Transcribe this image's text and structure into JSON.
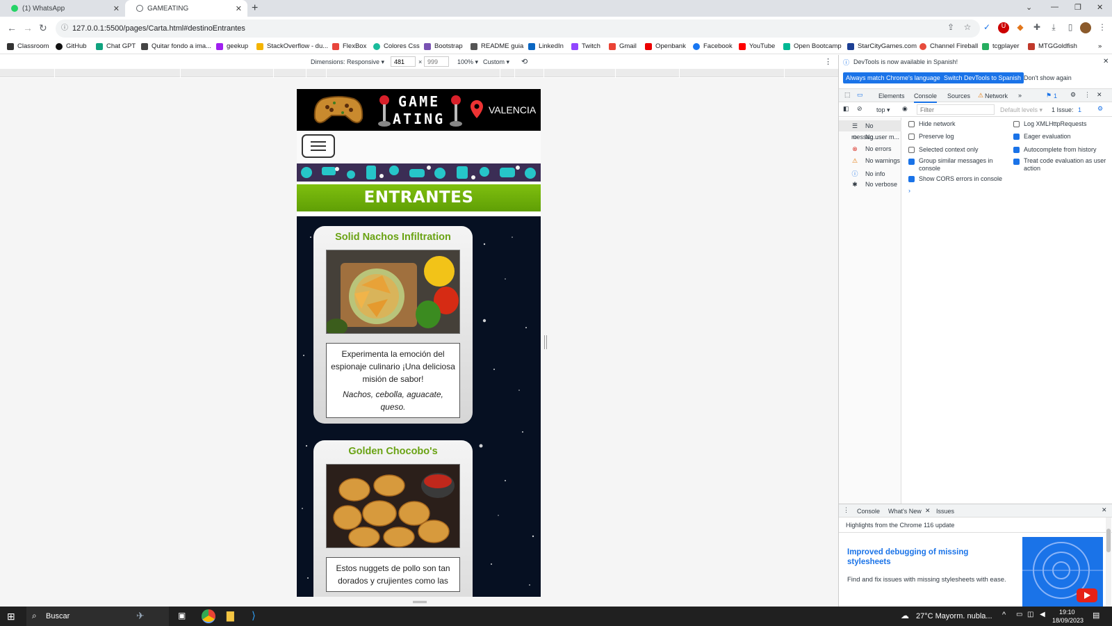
{
  "browser": {
    "tabs": [
      {
        "label": "(1) WhatsApp",
        "icon": "whatsapp-icon"
      },
      {
        "label": "GAMEATING",
        "icon": "globe-icon"
      }
    ],
    "url": "127.0.0.1:5500/pages/Carta.html#destinoEntrantes",
    "bookmarks": [
      "Classroom",
      "GitHub",
      "Chat GPT",
      "Quitar fondo a ima...",
      "geekup",
      "StackOverflow - du...",
      "FlexBox",
      "Colores Css",
      "Bootstrap",
      "README guia",
      "LinkedIn",
      "Twitch",
      "Gmail",
      "Openbank",
      "Facebook",
      "YouTube",
      "Open Bootcamp",
      "StarCityGames.com",
      "Channel Fireball",
      "tcgplayer",
      "MTGGoldfish"
    ]
  },
  "device_toolbar": {
    "dimensions_label": "Dimensions: Responsive ▾",
    "width": "481",
    "height": "999",
    "zoom": "100% ▾",
    "throttle": "Custom ▾"
  },
  "site": {
    "logo_line1": "GAME",
    "logo_line2": "ATING",
    "city": "VALENCIA",
    "section_title": "ENTRANTES",
    "cards": [
      {
        "title": "Solid Nachos Infiltration",
        "description": "Experimenta la emoción del espionaje culinario ¡Una deliciosa misión de sabor!",
        "ingredients": "Nachos, cebolla, aguacate, queso."
      },
      {
        "title": "Golden Chocobo's",
        "description": "Estos nuggets de pollo son tan dorados y crujientes como las"
      }
    ]
  },
  "devtools": {
    "banner_text": "DevTools is now available in Spanish!",
    "banner_btn1": "Always match Chrome's language",
    "banner_btn2": "Switch DevTools to Spanish",
    "banner_btn3": "Don't show again",
    "tabs": [
      "Elements",
      "Console",
      "Sources",
      "Network"
    ],
    "issue_count": "1",
    "context": "top ▾",
    "filter_placeholder": "Filter",
    "levels": "Default levels ▾",
    "issues_label": "1 Issue:",
    "issues_num": "1",
    "sidebar": [
      "No messag...",
      "No user m...",
      "No errors",
      "No warnings",
      "No info",
      "No verbose"
    ],
    "options_left": [
      "Hide network",
      "Preserve log",
      "Selected context only",
      "Group similar messages in console",
      "Show CORS errors in console"
    ],
    "options_right": [
      "Log XMLHttpRequests",
      "Eager evaluation",
      "Autocomplete from history",
      "Treat code evaluation as user action"
    ],
    "drawer_tabs": [
      "Console",
      "What's New",
      "Issues"
    ],
    "whatsnew_header": "Highlights from the Chrome 116 update",
    "whatsnew_title": "Improved debugging of missing stylesheets",
    "whatsnew_text": "Find and fix issues with missing stylesheets with ease."
  },
  "taskbar": {
    "search": "Buscar",
    "weather": "27°C  Mayorm. nubla...",
    "time": "19:10",
    "date": "18/09/2023"
  },
  "colors": {
    "accent_green": "#6aa314",
    "devtools_blue": "#1a73e8"
  }
}
